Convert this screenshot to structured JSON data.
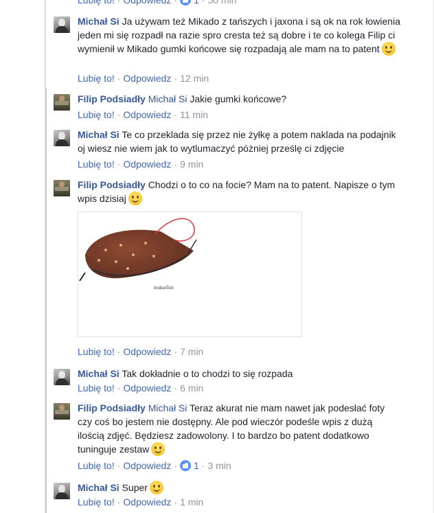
{
  "actions": {
    "like": "Lubię to!",
    "reply": "Odpowiedz",
    "sep": "·"
  },
  "top_partial": {
    "reaction_count": "1",
    "time": "50 min"
  },
  "comments": [
    {
      "author": "Michał Si",
      "avatar": "michal",
      "mention": "",
      "text": "Ja używam też Mikado z tańszych i jaxona i są ok na rok łowienia jeden mi się rozpadł na razie spro cresta też są dobre i te co kolega Filip ci wymienił w Mikado gumki końcowe się rozpadają ale mam na to patent",
      "emoji": "smile-icon",
      "time": "12 min"
    },
    {
      "author": "Filip Podsiadły",
      "avatar": "filip",
      "mention": "Michał Si",
      "text": "Jakie gumki końcowe?",
      "emoji": "",
      "time": "11 min"
    },
    {
      "author": "Michał Si",
      "avatar": "michal",
      "mention": "",
      "text": "Te co przeklada się przez nie żyłkę a potem naklada na podajnik oj wiesz nie wiem jak to wytlumaczyć póżniej prześlę ci zdjęcie",
      "emoji": "",
      "time": "9 min"
    },
    {
      "author": "Filip Podsiadły",
      "avatar": "filip",
      "mention": "",
      "text": "Chodzi o to co na focie? Mam na to patent. Napisze o tym wpis dzisiaj",
      "emoji": "smile-icon",
      "time": "7 min",
      "photo_caption": "mukurfish"
    },
    {
      "author": "Michał Si",
      "avatar": "michal",
      "mention": "",
      "text": "Tak dokładnie o to chodzi to się rozpada",
      "emoji": "",
      "time": "6 min"
    },
    {
      "author": "Filip Podsiadły",
      "avatar": "filip",
      "mention": "Michał Si",
      "text": "Teraz akurat nie mam nawet jak podesłać foty czy coś bo jestem nie dostępny. Ale pod wieczór podeśle wpis z dużą ilością zdjęć. Będziesz zadowolony. I to bardzo bo patent dodatkowo tuninguje zestaw",
      "emoji": "smile-icon",
      "time": "3 min",
      "likes": "1"
    },
    {
      "author": "Michał Si",
      "avatar": "michal",
      "mention": "",
      "text": "Super",
      "emoji": "smile-icon",
      "time": "1 min"
    }
  ]
}
